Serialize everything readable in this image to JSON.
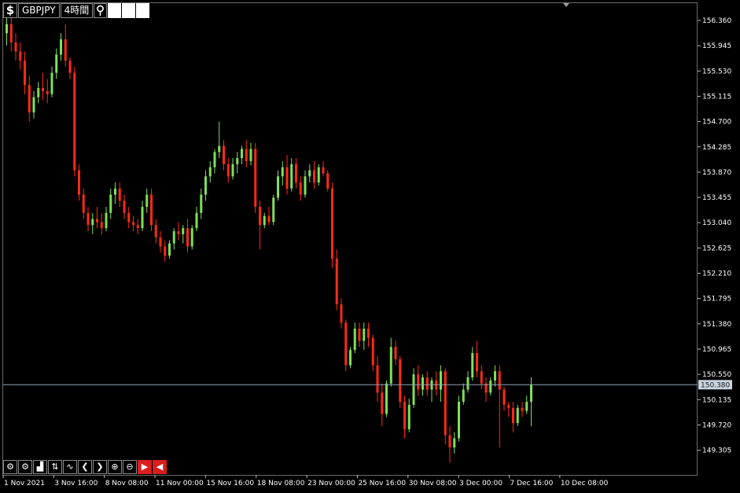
{
  "toolbar": {
    "symbol_icon": "$",
    "symbol": "GBPJPY",
    "timeframe": "4時間",
    "pin_icon": "pin-icon"
  },
  "bottom_toolbar": {
    "icons": [
      "settings-icon",
      "gear-icon",
      "bar-chart-icon",
      "candlestick-icon",
      "line-chart-icon",
      "arrow-left-icon",
      "arrow-right-icon",
      "zoom-in-icon",
      "zoom-out-icon",
      "shift-right-icon",
      "shift-left-icon"
    ],
    "glyphs": [
      "⚙",
      "⚙",
      "▟",
      "⇅",
      "∿",
      "❮",
      "❯",
      "⊕",
      "⊖",
      "▶",
      "◀"
    ]
  },
  "colors": {
    "up": "#7ee05a",
    "down": "#ff2a14",
    "axis": "#6a6a6a",
    "current_line": "#8fa4b8",
    "background": "#000000"
  },
  "price_axis": {
    "ticks": [
      "156.360",
      "155.945",
      "155.530",
      "155.115",
      "154.700",
      "154.285",
      "153.870",
      "153.455",
      "153.040",
      "152.625",
      "152.210",
      "151.795",
      "151.380",
      "150.965",
      "150.550",
      "150.135",
      "149.720",
      "149.305"
    ],
    "current_price": "150.380"
  },
  "time_axis": {
    "ticks": [
      "1 Nov 2021",
      "3 Nov 16:00",
      "8 Nov 08:00",
      "11 Nov 00:00",
      "15 Nov 16:00",
      "18 Nov 08:00",
      "23 Nov 00:00",
      "25 Nov 16:00",
      "30 Nov 08:00",
      "3 Dec 00:00",
      "7 Dec 16:00",
      "10 Dec 08:00"
    ]
  },
  "chart_data": {
    "type": "candlestick",
    "symbol": "GBPJPY",
    "timeframe": "4時間",
    "ylim": [
      149.0,
      156.6
    ],
    "current_price": 150.38,
    "candles": [
      [
        156.15,
        156.4,
        155.95,
        156.3
      ],
      [
        156.3,
        156.45,
        155.85,
        156.0
      ],
      [
        156.0,
        156.15,
        155.7,
        155.85
      ],
      [
        155.85,
        156.0,
        155.55,
        155.7
      ],
      [
        155.7,
        155.85,
        155.15,
        155.3
      ],
      [
        155.3,
        155.45,
        154.7,
        154.85
      ],
      [
        154.85,
        155.2,
        154.75,
        155.1
      ],
      [
        155.1,
        155.35,
        155.0,
        155.25
      ],
      [
        155.25,
        155.5,
        155.05,
        155.2
      ],
      [
        155.2,
        155.4,
        155.0,
        155.15
      ],
      [
        155.15,
        155.6,
        155.1,
        155.5
      ],
      [
        155.5,
        155.9,
        155.4,
        155.8
      ],
      [
        155.8,
        156.15,
        155.7,
        156.05
      ],
      [
        156.05,
        156.3,
        155.6,
        155.7
      ],
      [
        155.7,
        155.75,
        155.4,
        155.5
      ],
      [
        155.5,
        155.6,
        153.8,
        153.9
      ],
      [
        153.9,
        154.0,
        153.4,
        153.5
      ],
      [
        153.5,
        153.6,
        153.1,
        153.2
      ],
      [
        153.2,
        153.3,
        152.9,
        153.0
      ],
      [
        153.0,
        153.2,
        152.85,
        153.1
      ],
      [
        153.1,
        153.3,
        152.95,
        153.05
      ],
      [
        153.05,
        153.2,
        152.85,
        152.95
      ],
      [
        152.95,
        153.3,
        152.9,
        153.2
      ],
      [
        153.2,
        153.6,
        153.1,
        153.5
      ],
      [
        153.5,
        153.7,
        153.35,
        153.6
      ],
      [
        153.6,
        153.7,
        153.3,
        153.4
      ],
      [
        153.4,
        153.5,
        153.1,
        153.2
      ],
      [
        153.2,
        153.3,
        152.95,
        153.05
      ],
      [
        153.05,
        153.15,
        152.9,
        153.0
      ],
      [
        153.0,
        153.1,
        152.85,
        152.95
      ],
      [
        152.95,
        153.4,
        152.9,
        153.3
      ],
      [
        153.3,
        153.6,
        153.2,
        153.5
      ],
      [
        153.5,
        153.6,
        152.9,
        153.0
      ],
      [
        153.0,
        153.1,
        152.7,
        152.8
      ],
      [
        152.8,
        152.9,
        152.55,
        152.65
      ],
      [
        152.65,
        152.75,
        152.4,
        152.5
      ],
      [
        152.5,
        152.75,
        152.45,
        152.7
      ],
      [
        152.7,
        152.95,
        152.6,
        152.9
      ],
      [
        152.9,
        153.05,
        152.75,
        152.85
      ],
      [
        152.85,
        153.0,
        152.7,
        152.95
      ],
      [
        152.95,
        153.1,
        152.55,
        152.65
      ],
      [
        152.65,
        153.0,
        152.6,
        152.95
      ],
      [
        152.95,
        153.3,
        152.9,
        153.2
      ],
      [
        153.2,
        153.6,
        153.1,
        153.5
      ],
      [
        153.5,
        153.9,
        153.4,
        153.8
      ],
      [
        153.8,
        154.05,
        153.7,
        153.95
      ],
      [
        153.95,
        154.25,
        153.85,
        154.2
      ],
      [
        154.2,
        154.7,
        154.1,
        154.3
      ],
      [
        154.3,
        154.4,
        153.9,
        154.0
      ],
      [
        154.0,
        154.1,
        153.7,
        153.8
      ],
      [
        153.8,
        154.1,
        153.75,
        154.0
      ],
      [
        154.0,
        154.2,
        153.85,
        154.1
      ],
      [
        154.1,
        154.3,
        154.0,
        154.25
      ],
      [
        154.25,
        154.4,
        153.95,
        154.05
      ],
      [
        154.05,
        154.35,
        153.98,
        154.25
      ],
      [
        154.25,
        154.35,
        153.2,
        153.3
      ],
      [
        153.3,
        153.4,
        152.6,
        153.0
      ],
      [
        153.0,
        153.2,
        152.95,
        153.15
      ],
      [
        153.15,
        153.3,
        153.0,
        153.05
      ],
      [
        153.05,
        153.5,
        153.0,
        153.45
      ],
      [
        153.45,
        153.9,
        153.4,
        153.8
      ],
      [
        153.8,
        154.05,
        153.65,
        153.95
      ],
      [
        153.95,
        154.15,
        153.5,
        153.6
      ],
      [
        153.6,
        154.1,
        153.55,
        154.0
      ],
      [
        154.0,
        154.1,
        153.6,
        153.7
      ],
      [
        153.7,
        153.8,
        153.4,
        153.5
      ],
      [
        153.5,
        153.9,
        153.45,
        153.8
      ],
      [
        153.8,
        154.0,
        153.7,
        153.9
      ],
      [
        153.9,
        154.05,
        153.6,
        153.7
      ],
      [
        153.7,
        154.0,
        153.65,
        153.95
      ],
      [
        153.95,
        154.05,
        153.8,
        153.85
      ],
      [
        153.85,
        153.9,
        153.55,
        153.6
      ],
      [
        153.6,
        153.7,
        152.3,
        152.45
      ],
      [
        152.45,
        152.6,
        151.6,
        151.7
      ],
      [
        151.7,
        151.8,
        151.3,
        151.4
      ],
      [
        151.4,
        151.45,
        150.6,
        150.7
      ],
      [
        150.7,
        151.0,
        150.65,
        150.95
      ],
      [
        150.95,
        151.4,
        150.9,
        151.3
      ],
      [
        151.3,
        151.4,
        151.0,
        151.1
      ],
      [
        151.1,
        151.4,
        150.95,
        151.3
      ],
      [
        151.3,
        151.4,
        151.0,
        151.15
      ],
      [
        151.15,
        151.2,
        150.6,
        150.7
      ],
      [
        150.7,
        150.85,
        150.1,
        150.25
      ],
      [
        150.25,
        150.4,
        149.7,
        149.9
      ],
      [
        149.9,
        150.45,
        149.85,
        150.4
      ],
      [
        150.4,
        151.15,
        150.35,
        151.0
      ],
      [
        151.0,
        151.1,
        150.7,
        150.8
      ],
      [
        150.8,
        150.85,
        150.0,
        150.1
      ],
      [
        150.1,
        150.2,
        149.5,
        149.65
      ],
      [
        149.65,
        150.15,
        149.6,
        150.05
      ],
      [
        150.05,
        150.65,
        150.0,
        150.55
      ],
      [
        150.55,
        150.7,
        150.2,
        150.3
      ],
      [
        150.3,
        150.55,
        150.2,
        150.5
      ],
      [
        150.5,
        150.6,
        150.2,
        150.3
      ],
      [
        150.3,
        150.5,
        150.1,
        150.45
      ],
      [
        150.45,
        150.6,
        150.2,
        150.3
      ],
      [
        150.3,
        150.7,
        150.1,
        150.6
      ],
      [
        150.6,
        150.65,
        149.4,
        149.55
      ],
      [
        149.55,
        149.7,
        149.1,
        149.35
      ],
      [
        149.35,
        149.6,
        149.25,
        149.5
      ],
      [
        149.5,
        150.2,
        149.45,
        150.1
      ],
      [
        150.1,
        150.4,
        150.05,
        150.3
      ],
      [
        150.3,
        150.6,
        150.25,
        150.5
      ],
      [
        150.5,
        151.0,
        150.45,
        150.9
      ],
      [
        150.9,
        151.1,
        150.5,
        150.6
      ],
      [
        150.6,
        150.7,
        150.3,
        150.4
      ],
      [
        150.4,
        150.5,
        150.1,
        150.25
      ],
      [
        150.25,
        150.5,
        150.2,
        150.45
      ],
      [
        150.45,
        150.7,
        150.35,
        150.6
      ],
      [
        150.6,
        150.7,
        149.35,
        150.3
      ],
      [
        150.3,
        150.35,
        149.95,
        150.05
      ],
      [
        150.05,
        150.1,
        149.85,
        150.0
      ],
      [
        150.0,
        150.1,
        149.6,
        149.75
      ],
      [
        149.75,
        150.05,
        149.7,
        150.0
      ],
      [
        150.0,
        150.1,
        149.85,
        149.95
      ],
      [
        149.95,
        150.2,
        149.9,
        150.1
      ],
      [
        150.1,
        150.5,
        149.7,
        150.38
      ]
    ]
  }
}
